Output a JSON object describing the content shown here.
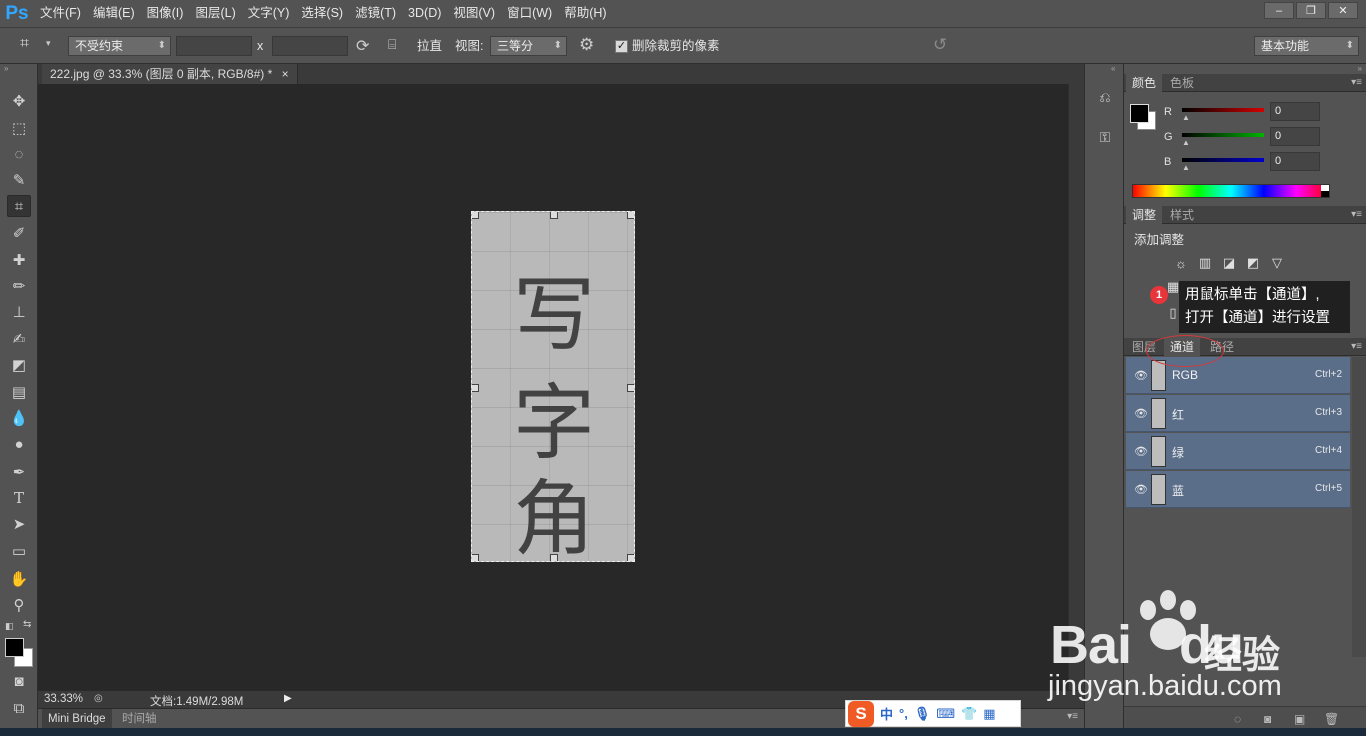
{
  "app": {
    "logo": "Ps"
  },
  "menu": [
    "文件(F)",
    "编辑(E)",
    "图像(I)",
    "图层(L)",
    "文字(Y)",
    "选择(S)",
    "滤镜(T)",
    "3D(D)",
    "视图(V)",
    "窗口(W)",
    "帮助(H)"
  ],
  "window_controls": {
    "minimize": "–",
    "restore": "❐",
    "close": "✕"
  },
  "options": {
    "ratio_select": "不受约束",
    "swap_symbol": "x",
    "straighten_label": "拉直",
    "view_label": "视图:",
    "view_select": "三等分",
    "delete_checkbox_checked": true,
    "delete_label": "删除裁剪的像素",
    "workspace_select": "基本功能"
  },
  "document": {
    "tab_title": "222.jpg @ 33.3% (图层 0 副本, RGB/8#) *",
    "tab_close": "×",
    "image_text": [
      "写",
      "字",
      "角"
    ]
  },
  "status": {
    "zoom": "33.33%",
    "doc_info": "文档:1.49M/2.98M"
  },
  "bottom_tabs": [
    "Mini Bridge",
    "时间轴"
  ],
  "panels": {
    "color": {
      "tabs": [
        "颜色",
        "色板"
      ],
      "sliders": [
        {
          "label": "R",
          "value": "0",
          "color": "#d40000"
        },
        {
          "label": "G",
          "value": "0",
          "color": "#00b400"
        },
        {
          "label": "B",
          "value": "0",
          "color": "#0000d0"
        }
      ]
    },
    "adjust": {
      "tabs": [
        "调整",
        "样式"
      ],
      "title": "添加调整"
    },
    "channels": {
      "tabs": [
        "图层",
        "通道",
        "路径"
      ],
      "rows": [
        {
          "name": "RGB",
          "shortcut": "Ctrl+2"
        },
        {
          "name": "红",
          "shortcut": "Ctrl+3"
        },
        {
          "name": "绿",
          "shortcut": "Ctrl+4"
        },
        {
          "name": "蓝",
          "shortcut": "Ctrl+5"
        }
      ]
    }
  },
  "callout": {
    "step": "1",
    "line1": "用鼠标单击【通道】,",
    "line2": "打开【通道】进行设置"
  },
  "ime": {
    "logo": "S",
    "mode": "中",
    "punct": "°,"
  },
  "watermark": {
    "brand": "Bai",
    "brand2": "du",
    "cn": "经验",
    "url": "jingyan.baidu.com"
  }
}
